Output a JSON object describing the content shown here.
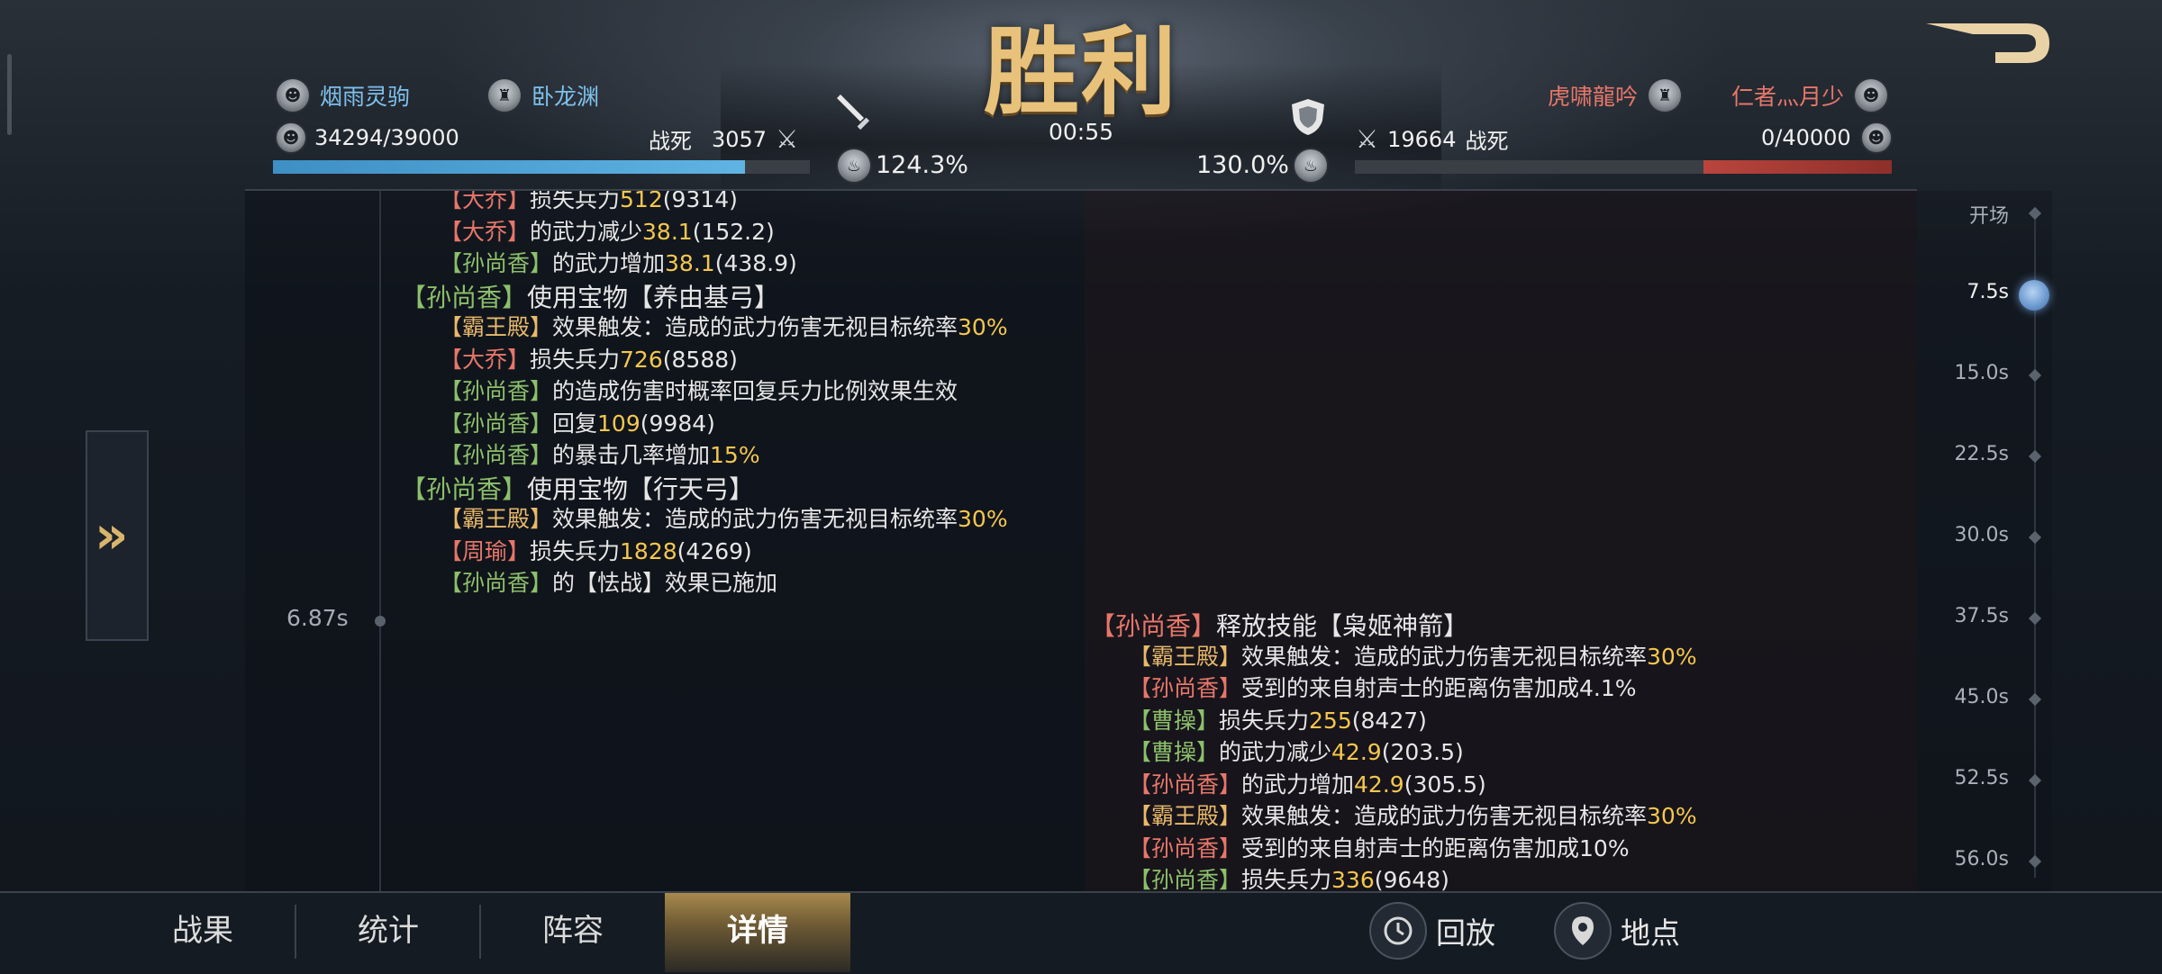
{
  "header": {
    "result_title": "胜利",
    "timer": "00:55",
    "left": {
      "players": [
        "烟雨灵驹",
        "卧龙渊"
      ],
      "troops": "34294/39000",
      "killed_label": "战死",
      "killed_value": "3057",
      "pct": "124.3%",
      "hp_fraction": 0.879
    },
    "right": {
      "players": [
        "虎啸龍吟",
        "仁者灬月少"
      ],
      "troops": "0/40000",
      "killed_label": "战死",
      "killed_value": "19664",
      "pct": "130.0%",
      "hp_fraction": 0.0
    }
  },
  "log": {
    "event_time": "6.87s",
    "left_lines": [
      {
        "seg": [
          {
            "t": "【大乔】",
            "c": "r"
          },
          {
            "t": "损失兵力",
            "c": "w"
          },
          {
            "t": "512",
            "c": "y"
          },
          {
            "t": "(9314)",
            "c": "w"
          }
        ]
      },
      {
        "seg": [
          {
            "t": "【大乔】",
            "c": "r"
          },
          {
            "t": "的武力减少",
            "c": "w"
          },
          {
            "t": "38.1",
            "c": "y"
          },
          {
            "t": "(152.2)",
            "c": "w"
          }
        ]
      },
      {
        "seg": [
          {
            "t": "【孙尚香】",
            "c": "g"
          },
          {
            "t": "的武力增加",
            "c": "w"
          },
          {
            "t": "38.1",
            "c": "y"
          },
          {
            "t": "(438.9)",
            "c": "w"
          }
        ]
      },
      {
        "h": true,
        "seg": [
          {
            "t": "【孙尚香】",
            "c": "g"
          },
          {
            "t": "使用宝物【养由基弓】",
            "c": "w"
          }
        ]
      },
      {
        "seg": [
          {
            "t": "【霸王殿】",
            "c": "o"
          },
          {
            "t": "效果触发：造成的武力伤害无视目标统率",
            "c": "w"
          },
          {
            "t": "30%",
            "c": "y"
          }
        ]
      },
      {
        "seg": [
          {
            "t": "【大乔】",
            "c": "r"
          },
          {
            "t": "损失兵力",
            "c": "w"
          },
          {
            "t": "726",
            "c": "y"
          },
          {
            "t": "(8588)",
            "c": "w"
          }
        ]
      },
      {
        "seg": [
          {
            "t": "【孙尚香】",
            "c": "g"
          },
          {
            "t": "的造成伤害时概率回复兵力比例效果生效",
            "c": "w"
          }
        ]
      },
      {
        "seg": [
          {
            "t": "【孙尚香】",
            "c": "g"
          },
          {
            "t": "回复",
            "c": "w"
          },
          {
            "t": "109",
            "c": "y"
          },
          {
            "t": "(9984)",
            "c": "w"
          }
        ]
      },
      {
        "seg": [
          {
            "t": "【孙尚香】",
            "c": "g"
          },
          {
            "t": "的暴击几率增加",
            "c": "w"
          },
          {
            "t": "15%",
            "c": "y"
          }
        ]
      },
      {
        "h": true,
        "seg": [
          {
            "t": "【孙尚香】",
            "c": "g"
          },
          {
            "t": "使用宝物【行天弓】",
            "c": "w"
          }
        ]
      },
      {
        "seg": [
          {
            "t": "【霸王殿】",
            "c": "o"
          },
          {
            "t": "效果触发：造成的武力伤害无视目标统率",
            "c": "w"
          },
          {
            "t": "30%",
            "c": "y"
          }
        ]
      },
      {
        "seg": [
          {
            "t": "【周瑜】",
            "c": "r"
          },
          {
            "t": "损失兵力",
            "c": "w"
          },
          {
            "t": "1828",
            "c": "y"
          },
          {
            "t": "(4269)",
            "c": "w"
          }
        ]
      },
      {
        "seg": [
          {
            "t": "【孙尚香】",
            "c": "g"
          },
          {
            "t": "的【怯战】效果已施加",
            "c": "w"
          }
        ]
      }
    ],
    "right_lines": [
      {
        "h": true,
        "seg": [
          {
            "t": "【孙尚香】",
            "c": "r"
          },
          {
            "t": "释放技能【枭姬神箭】",
            "c": "w"
          }
        ]
      },
      {
        "seg": [
          {
            "t": "【霸王殿】",
            "c": "o"
          },
          {
            "t": "效果触发：造成的武力伤害无视目标统率",
            "c": "w"
          },
          {
            "t": "30%",
            "c": "y"
          }
        ]
      },
      {
        "seg": [
          {
            "t": "【孙尚香】",
            "c": "r"
          },
          {
            "t": "受到的来自射声士的距离伤害加成4.1%",
            "c": "w"
          }
        ]
      },
      {
        "seg": [
          {
            "t": "【曹操】",
            "c": "g"
          },
          {
            "t": "损失兵力",
            "c": "w"
          },
          {
            "t": "255",
            "c": "y"
          },
          {
            "t": "(8427)",
            "c": "w"
          }
        ]
      },
      {
        "seg": [
          {
            "t": "【曹操】",
            "c": "g"
          },
          {
            "t": "的武力减少",
            "c": "w"
          },
          {
            "t": "42.9",
            "c": "y"
          },
          {
            "t": "(203.5)",
            "c": "w"
          }
        ]
      },
      {
        "seg": [
          {
            "t": "【孙尚香】",
            "c": "r"
          },
          {
            "t": "的武力增加",
            "c": "w"
          },
          {
            "t": "42.9",
            "c": "y"
          },
          {
            "t": "(305.5)",
            "c": "w"
          }
        ]
      },
      {
        "seg": [
          {
            "t": "【霸王殿】",
            "c": "o"
          },
          {
            "t": "效果触发：造成的武力伤害无视目标统率",
            "c": "w"
          },
          {
            "t": "30%",
            "c": "y"
          }
        ]
      },
      {
        "seg": [
          {
            "t": "【孙尚香】",
            "c": "r"
          },
          {
            "t": "受到的来自射声士的距离伤害加成10%",
            "c": "w"
          }
        ]
      },
      {
        "seg": [
          {
            "t": "【孙尚香】",
            "c": "g"
          },
          {
            "t": "损失兵力",
            "c": "w"
          },
          {
            "t": "336",
            "c": "y"
          },
          {
            "t": "(9648)",
            "c": "w"
          }
        ]
      }
    ]
  },
  "timeline": {
    "ticks": [
      "开场",
      "7.5s",
      "15.0s",
      "22.5s",
      "30.0s",
      "37.5s",
      "45.0s",
      "52.5s",
      "56.0s"
    ],
    "active_index": 1
  },
  "tabs": [
    "战果",
    "统计",
    "阵容",
    "详情"
  ],
  "active_tab": 3,
  "actions": {
    "replay": "回放",
    "location": "地点"
  },
  "icons": {
    "back": "back-arrow-icon",
    "expand": "double-chevron-right-icon",
    "sword": "sword-icon",
    "shield": "shield-icon"
  }
}
